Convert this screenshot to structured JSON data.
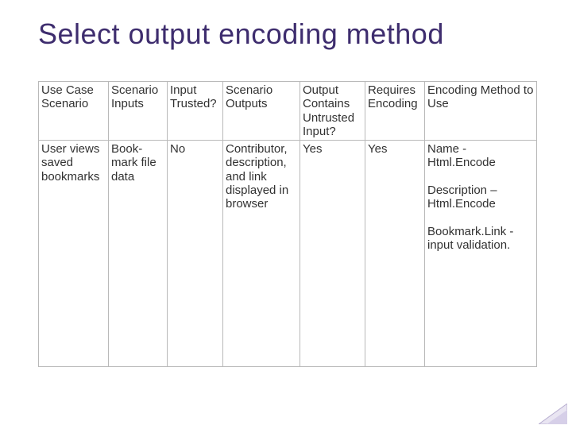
{
  "title": "Select output encoding method",
  "table": {
    "headers": [
      "Use Case Scenario",
      "Scenario Inputs",
      "Input Trusted?",
      "Scenario Outputs",
      "Output Contains Untrusted Input?",
      "Requires Encoding",
      "Encoding Method to Use"
    ],
    "row": {
      "scenario": "User views saved bookmarks",
      "inputs": "Book-mark file data",
      "trusted": "No",
      "outputs": "Contributor, description, and link displayed in browser",
      "contains": "Yes",
      "requires": "Yes",
      "method": "Name - Html.Encode\n\nDescription – Html.Encode\n\nBookmark.Link - input validation."
    }
  }
}
